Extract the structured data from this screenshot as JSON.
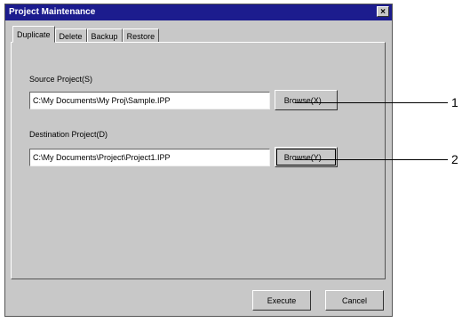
{
  "window": {
    "title": "Project Maintenance",
    "close_glyph": "×"
  },
  "tabs": [
    {
      "label": "Duplicate",
      "active": true
    },
    {
      "label": "Delete"
    },
    {
      "label": "Backup"
    },
    {
      "label": "Restore"
    }
  ],
  "source": {
    "label": "Source Project(S)",
    "value": "C:\\My Documents\\My Proj\\Sample.IPP",
    "browse_label": "Browse(X)..."
  },
  "destination": {
    "label": "Destination Project(D)",
    "value": "C:\\My Documents\\Project\\Project1.IPP",
    "browse_label": "Browse(Y)..."
  },
  "footer": {
    "execute_label": "Execute",
    "cancel_label": "Cancel"
  },
  "callouts": [
    "1",
    "2"
  ]
}
